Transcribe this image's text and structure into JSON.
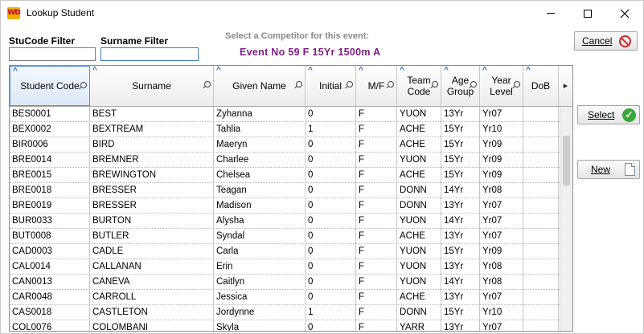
{
  "window": {
    "title": "Lookup Student",
    "app_icon_text": "WD"
  },
  "filters": {
    "stucode_label": "StuCode Filter",
    "stucode_value": "",
    "surname_label": "Surname Filter",
    "surname_value": ""
  },
  "prompt": "Select a Competitor for this event:",
  "event": "Event No 59 F 15Yr 1500m A",
  "buttons": {
    "cancel": "Cancel",
    "select": "Select",
    "new": "New"
  },
  "icons": {
    "cancel": "no-entry-icon",
    "select": "check-circle-icon",
    "new": "new-document-icon"
  },
  "columns": [
    "Student Code",
    "Surname",
    "Given Name",
    "Initial",
    "M/F",
    "Team Code",
    "Age Group",
    "Year Level",
    "DoB"
  ],
  "rows": [
    [
      "BES0001",
      "BEST",
      "Zyhanna",
      "0",
      "F",
      "YUON",
      "13Yr",
      "Yr07"
    ],
    [
      "BEX0002",
      "BEXTREAM",
      "Tahlia",
      "1",
      "F",
      "ACHE",
      "15Yr",
      "Yr10"
    ],
    [
      "BIR0006",
      "BIRD",
      "Maeryn",
      "0",
      "F",
      "ACHE",
      "15Yr",
      "Yr09"
    ],
    [
      "BRE0014",
      "BREMNER",
      "Charlee",
      "0",
      "F",
      "YUON",
      "15Yr",
      "Yr09"
    ],
    [
      "BRE0015",
      "BREWINGTON",
      "Chelsea",
      "0",
      "F",
      "ACHE",
      "15Yr",
      "Yr09"
    ],
    [
      "BRE0018",
      "BRESSER",
      "Teagan",
      "0",
      "F",
      "DONN",
      "14Yr",
      "Yr08"
    ],
    [
      "BRE0019",
      "BRESSER",
      "Madison",
      "0",
      "F",
      "DONN",
      "13Yr",
      "Yr07"
    ],
    [
      "BUR0033",
      "BURTON",
      "Alysha",
      "0",
      "F",
      "YUON",
      "14Yr",
      "Yr07"
    ],
    [
      "BUT0008",
      "BUTLER",
      "Syndal",
      "0",
      "F",
      "ACHE",
      "13Yr",
      "Yr07"
    ],
    [
      "CAD0003",
      "CADLE",
      "Carla",
      "0",
      "F",
      "YUON",
      "15Yr",
      "Yr09"
    ],
    [
      "CAL0014",
      "CALLANAN",
      "Erin",
      "0",
      "F",
      "YUON",
      "13Yr",
      "Yr08"
    ],
    [
      "CAN0013",
      "CANEVA",
      "Caitlyn",
      "0",
      "F",
      "YUON",
      "14Yr",
      "Yr08"
    ],
    [
      "CAR0048",
      "CARROLL",
      "Jessica",
      "0",
      "F",
      "ACHE",
      "13Yr",
      "Yr07"
    ],
    [
      "CAS0018",
      "CASTLETON",
      "Jordynne",
      "1",
      "F",
      "DONN",
      "15Yr",
      "Yr10"
    ],
    [
      "COL0076",
      "COLOMBANI",
      "Skyla",
      "0",
      "F",
      "YARR",
      "13Yr",
      "Yr07"
    ]
  ]
}
